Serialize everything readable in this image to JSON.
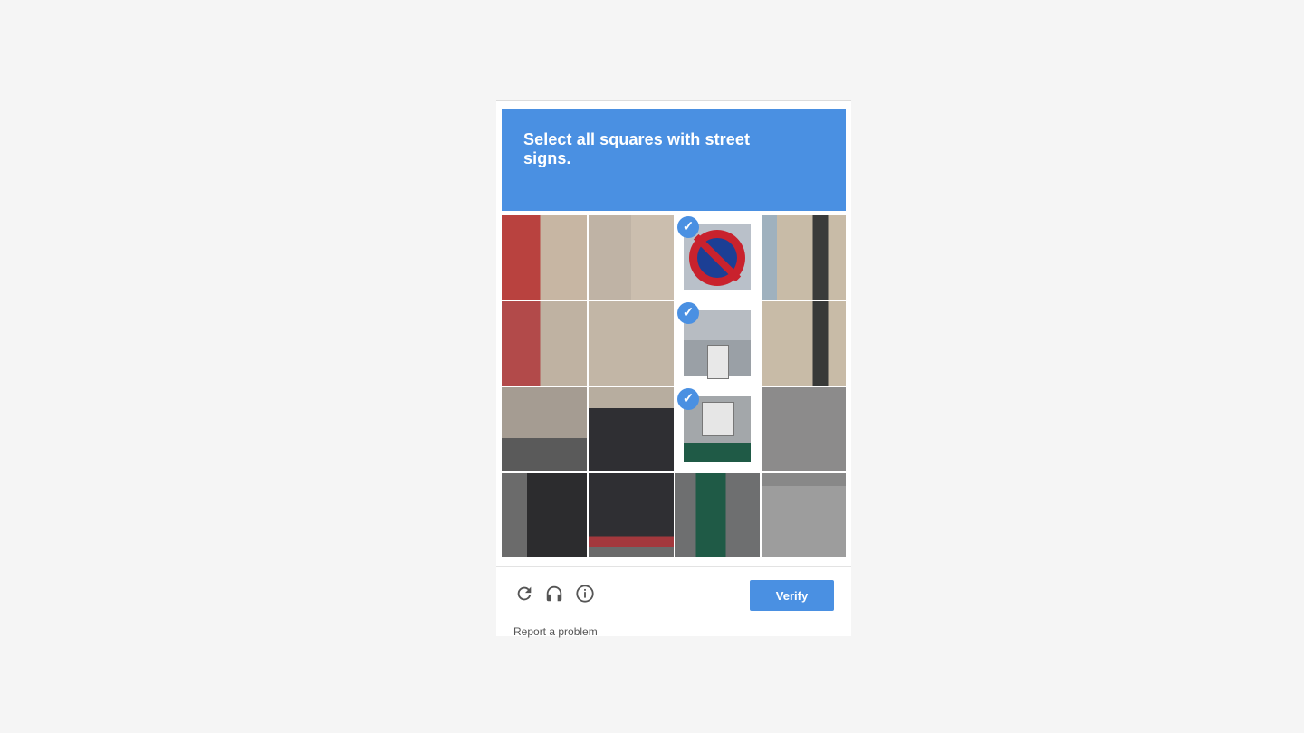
{
  "header": {
    "line1": "Select all squares with street",
    "line2": "signs."
  },
  "grid": {
    "rows": 4,
    "cols": 4,
    "selected_cells": [
      {
        "row": 1,
        "col": 3,
        "content": "no-parking-sign"
      },
      {
        "row": 2,
        "col": 3,
        "content": "tow-away-sign"
      },
      {
        "row": 3,
        "col": 3,
        "content": "arrow-sign"
      }
    ]
  },
  "footer": {
    "reload_icon": "reload-icon",
    "audio_icon": "headphones-icon",
    "info_icon": "info-icon",
    "report_label": "Report a problem",
    "verify_label": "Verify"
  },
  "colors": {
    "accent": "#4a90e2",
    "background": "#f5f5f5"
  }
}
